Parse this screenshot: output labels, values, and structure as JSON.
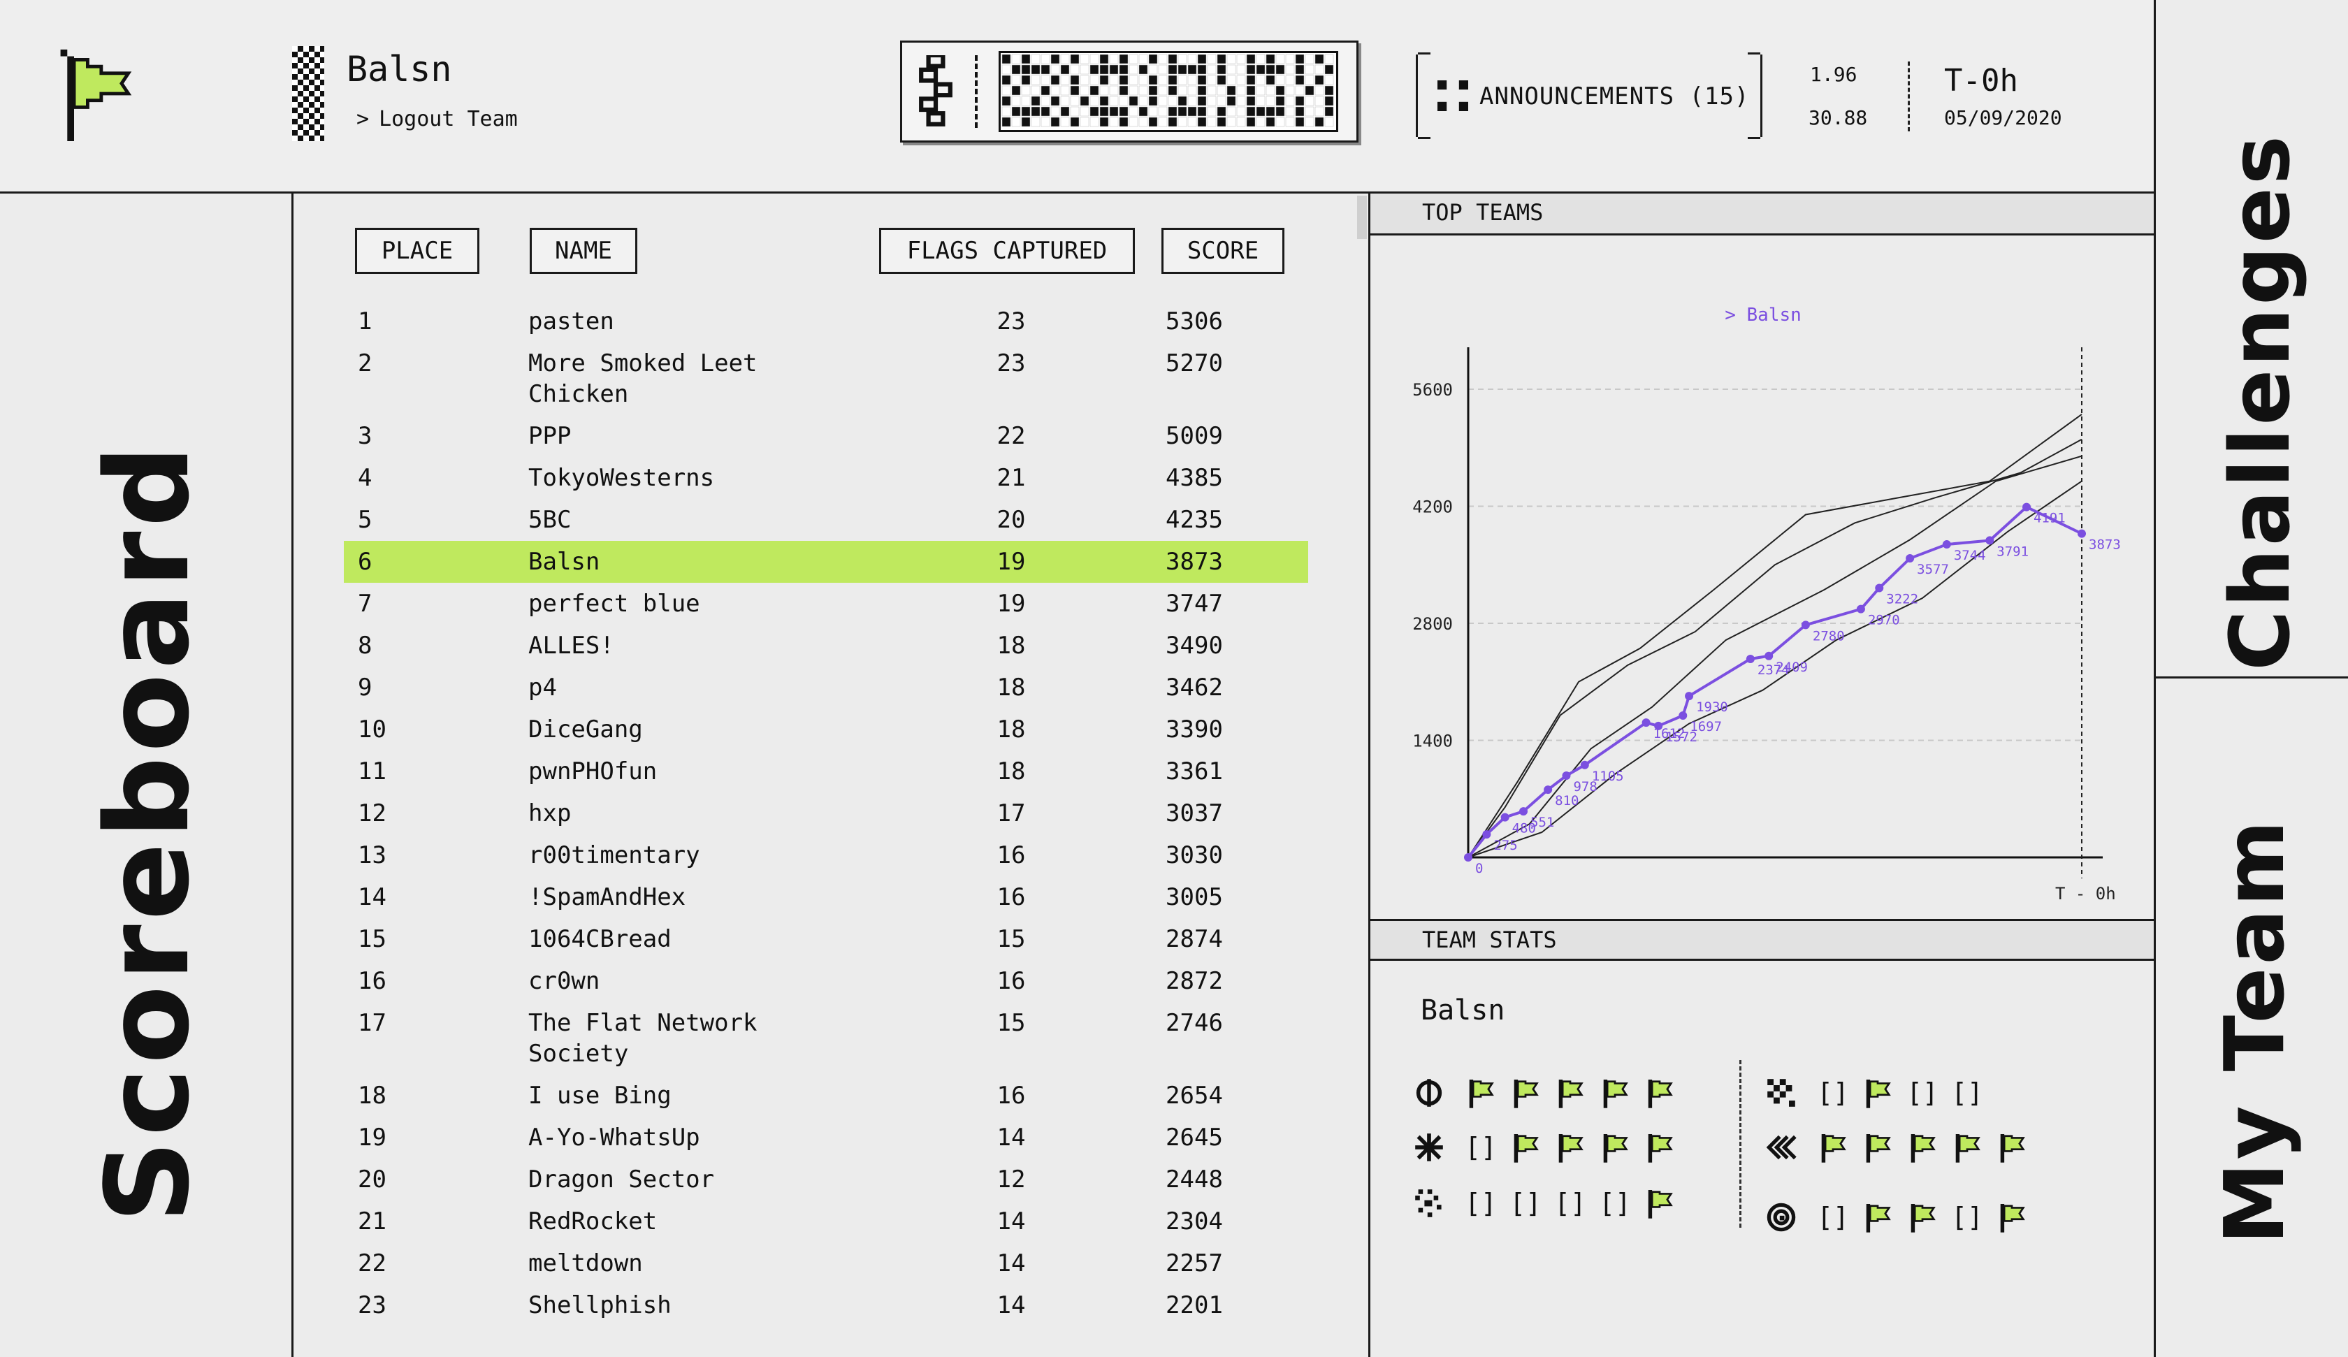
{
  "header": {
    "team_name": "Balsn",
    "logout_label": "Logout Team",
    "announcements_label": "ANNOUNCEMENTS (15)",
    "stat_a": "1.96",
    "stat_b": "30.88",
    "timer": "T-0h",
    "date": "05/09/2020"
  },
  "nav": {
    "scoreboard": "Scoreboard",
    "challenges": "Challenges",
    "my_team": "My Team"
  },
  "scoreboard": {
    "columns": {
      "place": "PLACE",
      "name": "NAME",
      "flags": "FLAGS CAPTURED",
      "score": "SCORE"
    },
    "highlight_color": "#bfe95e",
    "rows": [
      {
        "place": "1",
        "name": "pasten",
        "flags": "23",
        "score": "5306"
      },
      {
        "place": "2",
        "name": "More Smoked Leet\nChicken",
        "flags": "23",
        "score": "5270"
      },
      {
        "place": "3",
        "name": "PPP",
        "flags": "22",
        "score": "5009"
      },
      {
        "place": "4",
        "name": "TokyoWesterns",
        "flags": "21",
        "score": "4385"
      },
      {
        "place": "5",
        "name": "5BC",
        "flags": "20",
        "score": "4235"
      },
      {
        "place": "6",
        "name": "Balsn",
        "flags": "19",
        "score": "3873",
        "highlight": true
      },
      {
        "place": "7",
        "name": "perfect blue",
        "flags": "19",
        "score": "3747"
      },
      {
        "place": "8",
        "name": "ALLES!",
        "flags": "18",
        "score": "3490"
      },
      {
        "place": "9",
        "name": "p4",
        "flags": "18",
        "score": "3462"
      },
      {
        "place": "10",
        "name": "DiceGang",
        "flags": "18",
        "score": "3390"
      },
      {
        "place": "11",
        "name": "pwnPHOfun",
        "flags": "18",
        "score": "3361"
      },
      {
        "place": "12",
        "name": "hxp",
        "flags": "17",
        "score": "3037"
      },
      {
        "place": "13",
        "name": "r00timentary",
        "flags": "16",
        "score": "3030"
      },
      {
        "place": "14",
        "name": "!SpamAndHex",
        "flags": "16",
        "score": "3005"
      },
      {
        "place": "15",
        "name": "1064CBread",
        "flags": "15",
        "score": "2874"
      },
      {
        "place": "16",
        "name": "cr0wn",
        "flags": "16",
        "score": "2872"
      },
      {
        "place": "17",
        "name": "The Flat Network\nSociety",
        "flags": "15",
        "score": "2746"
      },
      {
        "place": "18",
        "name": "I use Bing",
        "flags": "16",
        "score": "2654"
      },
      {
        "place": "19",
        "name": "A-Yo-WhatsUp",
        "flags": "14",
        "score": "2645"
      },
      {
        "place": "20",
        "name": "Dragon Sector",
        "flags": "12",
        "score": "2448"
      },
      {
        "place": "21",
        "name": "RedRocket",
        "flags": "14",
        "score": "2304"
      },
      {
        "place": "22",
        "name": "meltdown",
        "flags": "14",
        "score": "2257"
      },
      {
        "place": "23",
        "name": "Shellphish",
        "flags": "14",
        "score": "2201"
      }
    ]
  },
  "top_teams": {
    "title": "TOP TEAMS",
    "chart_data": {
      "type": "line",
      "legend": "Balsn",
      "legend_placement": "top",
      "accent_color": "#7b4fe0",
      "ylim": [
        0,
        5600
      ],
      "yticks": [
        1400,
        2800,
        4200,
        5600
      ],
      "x_end_label": "T - 0h",
      "grid": true,
      "series": [
        {
          "name": "Balsn",
          "x": [
            0,
            3,
            6,
            9,
            13,
            16,
            19,
            29,
            31,
            35,
            36,
            46,
            49,
            55,
            64,
            67,
            72,
            78,
            85,
            91,
            100
          ],
          "y": [
            0,
            275,
            480,
            551,
            810,
            978,
            1105,
            1612,
            1572,
            1697,
            1930,
            2374,
            2409,
            2780,
            2970,
            3222,
            3577,
            3744,
            3791,
            4191,
            3873
          ],
          "labels": [
            "0",
            "275",
            "480",
            "551",
            "810",
            "978",
            "1105",
            "1612",
            "1572",
            "1697",
            "1930",
            "2374",
            "2409",
            "2780",
            "2970",
            "3222",
            "3577",
            "3744",
            "3791",
            "4191",
            "3873"
          ]
        },
        {
          "x": [
            0,
            8,
            18,
            28,
            40,
            55,
            70,
            85,
            100
          ],
          "y": [
            0,
            900,
            2100,
            2500,
            3200,
            4100,
            4300,
            4500,
            5300
          ]
        },
        {
          "x": [
            0,
            6,
            15,
            26,
            37,
            50,
            63,
            76,
            90,
            100
          ],
          "y": [
            0,
            600,
            1700,
            2300,
            2700,
            3500,
            4000,
            4300,
            4600,
            5000
          ]
        },
        {
          "x": [
            0,
            10,
            20,
            30,
            42,
            58,
            72,
            86,
            100
          ],
          "y": [
            0,
            400,
            1300,
            1800,
            2600,
            3200,
            3800,
            4500,
            4800
          ]
        },
        {
          "x": [
            0,
            12,
            24,
            36,
            48,
            60,
            74,
            88,
            100
          ],
          "y": [
            0,
            300,
            1000,
            1600,
            2000,
            2600,
            3100,
            3900,
            4500
          ]
        }
      ]
    }
  },
  "team_stats": {
    "title": "TEAM STATS",
    "team": "Balsn",
    "flag_color": "#bfe95e",
    "categories": [
      {
        "icon": "phi-icon",
        "cells": [
          "flag",
          "flag",
          "flag",
          "flag",
          "flag"
        ]
      },
      {
        "icon": "asterisk-icon",
        "cells": [
          "[]",
          "flag",
          "flag",
          "flag",
          "flag"
        ]
      },
      {
        "icon": "dither-icon",
        "cells": [
          "[]",
          "[]",
          "[]",
          "[]",
          "flag"
        ]
      },
      {
        "icon": "checker-icon",
        "cells": [
          "[]",
          "flag",
          "[]",
          "[]"
        ]
      },
      {
        "icon": "double-chevron-icon",
        "cells": [
          "flag",
          "flag",
          "flag",
          "flag",
          "flag"
        ]
      },
      {
        "icon": "spiral-icon",
        "cells": [
          "[]",
          "flag",
          "flag",
          "[]",
          "flag"
        ]
      }
    ]
  }
}
